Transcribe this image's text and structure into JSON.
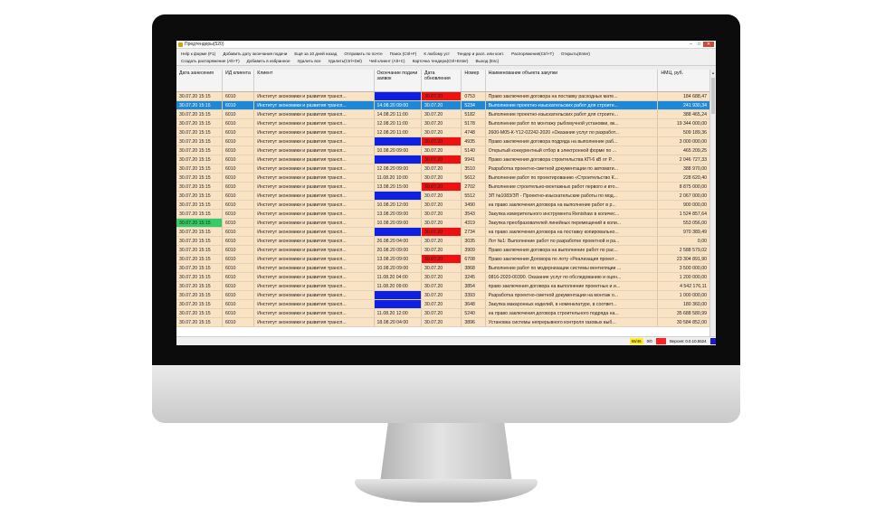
{
  "colors": {
    "selected": "#1e88d8",
    "row": "#f9e3c4",
    "blue": "#1020e0",
    "red": "#ee1111",
    "green": "#33cc66",
    "status_yellow": "#ffee22",
    "status_red": "#ff2222",
    "status_blue": "#1a1acc"
  },
  "window": {
    "title": "Предтендеры(520)",
    "min": "–",
    "max": "□",
    "close": "✕"
  },
  "menu": {
    "row1": [
      "Help к форме (F1)",
      "Добавить дату окончания подачи",
      "Ещё за 10 дней назад",
      "Отправить по почте",
      "Поиск (Ctrl+F)",
      "К любому уст",
      "Тендер и расп. или конт.",
      "Распоряжения(Ctrl+T)",
      "Открыть(Enter)"
    ],
    "row2": [
      "Создать распоряжение (Alt+T)",
      "Добавить в избранное",
      "Удалить все",
      "Удалить(Ctrl+Del)",
      "Чей клиент (Alt+C)",
      "Карточка тендера(Ctrl+Enter)",
      "Выход (Esc)"
    ]
  },
  "columns": [
    "Дата занесения",
    "ИД клиента",
    "Клиент",
    "Окончание подачи заявок",
    "Дата обновления",
    "Номер",
    "Наименование объекта закупки",
    "НМЦ, руб."
  ],
  "rows": [
    {
      "date": "30.07.20 15:15",
      "id": "6010",
      "client": "Институт экономики и развития трансп...",
      "end": "",
      "end_color": "blue",
      "upd": "30.07.20",
      "upd_color": "red",
      "num": "0753",
      "name": "Право заключения договора на поставку расходных мате...",
      "price": "184 688,47",
      "selected": false,
      "date_color": ""
    },
    {
      "date": "30.07.20 15:15",
      "id": "6010",
      "client": "Институт экономики и развития трансп...",
      "end": "14.08.20 09:00",
      "end_color": "",
      "upd": "30.07.20",
      "upd_color": "",
      "num": "5234",
      "name": "Выполнение проектно-изыскательских работ для строите...",
      "price": "241 930,34",
      "selected": true,
      "date_color": ""
    },
    {
      "date": "30.07.20 15:15",
      "id": "6010",
      "client": "Институт экономики и развития трансп...",
      "end": "14.08.20 11:00",
      "end_color": "",
      "upd": "30.07.20",
      "upd_color": "",
      "num": "5182",
      "name": "Выполнение проектно-изыскательских работ для строите...",
      "price": "388 465,24",
      "selected": false,
      "date_color": ""
    },
    {
      "date": "30.07.20 15:15",
      "id": "6010",
      "client": "Институт экономики и развития трансп...",
      "end": "12.08.20 11:00",
      "end_color": "",
      "upd": "30.07.20",
      "upd_color": "",
      "num": "5178",
      "name": "Выполнение работ по монтажу рыбомучной установки, вк...",
      "price": "19 344 000,00",
      "selected": false,
      "date_color": ""
    },
    {
      "date": "30.07.20 15:15",
      "id": "6010",
      "client": "Институт экономики и развития трансп...",
      "end": "12.08.20 11:00",
      "end_color": "",
      "upd": "30.07.20",
      "upd_color": "",
      "num": "4748",
      "name": "2600-М05-К-Y12-02242-2020 «Оказание услуг по разработ...",
      "price": "509 189,36",
      "selected": false,
      "date_color": ""
    },
    {
      "date": "30.07.20 15:15",
      "id": "6010",
      "client": "Институт экономики и развития трансп...",
      "end": "",
      "end_color": "blue",
      "upd": "30.07.20",
      "upd_color": "red",
      "num": "4935",
      "name": "Право заключения договора подряда на выполнение раб...",
      "price": "3 000 000,00",
      "selected": false,
      "date_color": ""
    },
    {
      "date": "30.07.20 15:15",
      "id": "6010",
      "client": "Институт экономики и развития трансп...",
      "end": "10.08.20 09:00",
      "end_color": "",
      "upd": "30.07.20",
      "upd_color": "",
      "num": "5140",
      "name": "Открытый конкурентный отбор в электронной форме по ...",
      "price": "465 209,25",
      "selected": false,
      "date_color": ""
    },
    {
      "date": "30.07.20 15:15",
      "id": "6010",
      "client": "Институт экономики и развития трансп...",
      "end": "",
      "end_color": "blue",
      "upd": "30.07.20",
      "upd_color": "red",
      "num": "9941",
      "name": "Право заключения договора строительства КП-6 кВ от Р...",
      "price": "2 046 727,33",
      "selected": false,
      "date_color": ""
    },
    {
      "date": "30.07.20 15:15",
      "id": "6010",
      "client": "Институт экономики и развития трансп...",
      "end": "12.08.20 09:00",
      "end_color": "",
      "upd": "30.07.20",
      "upd_color": "",
      "num": "3510",
      "name": "Разработка проектно-сметной документации по автомати...",
      "price": "388 970,00",
      "selected": false,
      "date_color": ""
    },
    {
      "date": "30.07.20 15:15",
      "id": "6010",
      "client": "Институт экономики и развития трансп...",
      "end": "11.08.20 10:00",
      "end_color": "",
      "upd": "30.07.20",
      "upd_color": "",
      "num": "5612",
      "name": "Выполнение работ по проектированию «Строительство К...",
      "price": "228 620,40",
      "selected": false,
      "date_color": ""
    },
    {
      "date": "30.07.20 15:15",
      "id": "6010",
      "client": "Институт экономики и развития трансп...",
      "end": "13.08.20 15:00",
      "end_color": "",
      "upd": "30.07.20",
      "upd_color": "red",
      "num": "2702",
      "name": "Выполнение строительно-монтажных работ первого и вто...",
      "price": "8 875 000,00",
      "selected": false,
      "date_color": ""
    },
    {
      "date": "30.07.20 15:15",
      "id": "6010",
      "client": "Институт экономики и развития трансп...",
      "end": "",
      "end_color": "blue",
      "upd": "30.07.20",
      "upd_color": "",
      "num": "5512",
      "name": "ЗП №1083/ЗП - Проектно-изыскательские работы по мод...",
      "price": "2 067 000,00",
      "selected": false,
      "date_color": ""
    },
    {
      "date": "30.07.20 15:15",
      "id": "6010",
      "client": "Институт экономики и развития трансп...",
      "end": "10.08.20 12:00",
      "end_color": "",
      "upd": "30.07.20",
      "upd_color": "",
      "num": "3490",
      "name": "на право заключения договора на выполнение работ в р...",
      "price": "900 000,00",
      "selected": false,
      "date_color": ""
    },
    {
      "date": "30.07.20 15:15",
      "id": "6010",
      "client": "Институт экономики и развития трансп...",
      "end": "13.08.20 09:00",
      "end_color": "",
      "upd": "30.07.20",
      "upd_color": "",
      "num": "3543",
      "name": "Закупка измерительного инструмента Renishaw в количес...",
      "price": "1 524 857,64",
      "selected": false,
      "date_color": ""
    },
    {
      "date": "30.07.20 15:15",
      "id": "6010",
      "client": "Институт экономики и развития трансп...",
      "end": "10.08.20 09:00",
      "end_color": "",
      "upd": "30.07.20",
      "upd_color": "",
      "num": "4319",
      "name": "Закупка преобразователей линейных перемещений в коли...",
      "price": "553 056,00",
      "selected": false,
      "date_color": "green"
    },
    {
      "date": "30.07.20 15:15",
      "id": "6010",
      "client": "Институт экономики и развития трансп...",
      "end": "",
      "end_color": "blue",
      "upd": "30.07.20",
      "upd_color": "red",
      "num": "2734",
      "name": "на право заключения договора на поставку копировально...",
      "price": "970 389,49",
      "selected": false,
      "date_color": ""
    },
    {
      "date": "30.07.20 15:15",
      "id": "6010",
      "client": "Институт экономики и развития трансп...",
      "end": "26.08.20 04:00",
      "end_color": "",
      "upd": "30.07.20",
      "upd_color": "",
      "num": "3035",
      "name": "Лот №1: Выполнение работ по разработке проектной и ра...",
      "price": "0,00",
      "selected": false,
      "date_color": ""
    },
    {
      "date": "30.07.20 15:15",
      "id": "6010",
      "client": "Институт экономики и развития трансп...",
      "end": "20.08.20 09:00",
      "end_color": "",
      "upd": "30.07.20",
      "upd_color": "",
      "num": "3909",
      "name": "Право заключения договора на выполнение работ по рас...",
      "price": "2 588 579,02",
      "selected": false,
      "date_color": ""
    },
    {
      "date": "30.07.20 15:15",
      "id": "6010",
      "client": "Институт экономики и развития трансп...",
      "end": "13.08.20 09:00",
      "end_color": "",
      "upd": "30.07.20",
      "upd_color": "red",
      "num": "6708",
      "name": "Право заключения Договора по лоту «Реализация проект...",
      "price": "23 304 891,90",
      "selected": false,
      "date_color": ""
    },
    {
      "date": "30.07.20 15:15",
      "id": "6010",
      "client": "Институт экономики и развития трансп...",
      "end": "10.08.20 09:00",
      "end_color": "",
      "upd": "30.07.20",
      "upd_color": "",
      "num": "3868",
      "name": "Выполнение работ по модернизации системы вентиляции ...",
      "price": "3 500 000,00",
      "selected": false,
      "date_color": ""
    },
    {
      "date": "30.07.20 15:15",
      "id": "6010",
      "client": "Институт экономики и развития трансп...",
      "end": "11.08.20 04:00",
      "end_color": "",
      "upd": "30.07.20",
      "upd_color": "",
      "num": "3245",
      "name": "0816-2020-00390. Оказание услуг по обследованию и оцен...",
      "price": "1 200 000,00",
      "selected": false,
      "date_color": ""
    },
    {
      "date": "30.07.20 15:15",
      "id": "6010",
      "client": "Институт экономики и развития трансп...",
      "end": "11.08.20 09:00",
      "end_color": "",
      "upd": "30.07.20",
      "upd_color": "",
      "num": "3854",
      "name": "право заключения договора на выполнение проектных и и...",
      "price": "4 542 176,11",
      "selected": false,
      "date_color": ""
    },
    {
      "date": "30.07.20 15:15",
      "id": "6010",
      "client": "Институт экономики и развития трансп...",
      "end": "",
      "end_color": "blue",
      "upd": "30.07.20",
      "upd_color": "",
      "num": "3393",
      "name": "Разработка проектно-сметной документации на монтаж о...",
      "price": "1 000 000,00",
      "selected": false,
      "date_color": ""
    },
    {
      "date": "30.07.20 15:15",
      "id": "6010",
      "client": "Институт экономики и развития трансп...",
      "end": "",
      "end_color": "blue",
      "upd": "30.07.20",
      "upd_color": "",
      "num": "3648",
      "name": "Закупка макаронных изделий, в номенклатуре, в соответ...",
      "price": "180 360,00",
      "selected": false,
      "date_color": ""
    },
    {
      "date": "30.07.20 15:15",
      "id": "6010",
      "client": "Институт экономики и развития трансп...",
      "end": "11.08.20 12:00",
      "end_color": "",
      "upd": "30.07.20",
      "upd_color": "",
      "num": "5240",
      "name": "на право заключения договора строительного подряда на...",
      "price": "35 688 580,99",
      "selected": false,
      "date_color": ""
    },
    {
      "date": "30.07.20 15:15",
      "id": "6010",
      "client": "Институт экономики и развития трансп...",
      "end": "18.08.20 04:00",
      "end_color": "",
      "upd": "30.07.20",
      "upd_color": "",
      "num": "3896",
      "name": "Установка системы непрерывного контроля газовых выб...",
      "price": "30 584 852,00",
      "selected": false,
      "date_color": ""
    }
  ],
  "status": {
    "yellow": "65/46",
    "count": "0/0",
    "version": "Версия: 0.0.10.5524"
  }
}
